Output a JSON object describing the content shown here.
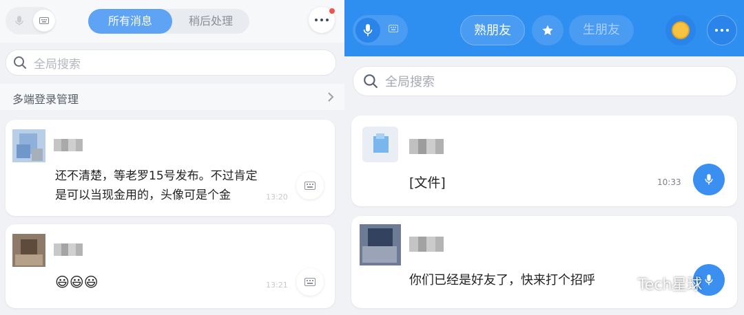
{
  "left": {
    "tabs": [
      {
        "label": "所有消息",
        "active": true
      },
      {
        "label": "稍后处理",
        "active": false
      }
    ],
    "search": {
      "placeholder": "全局搜索"
    },
    "multi_device": {
      "label": "多端登录管理"
    },
    "messages": [
      {
        "text_line1": "还不清楚，等老罗15号发布。不过肯定",
        "text_line2": "是可以当现金用的，头像可是个金",
        "time": "13:20"
      },
      {
        "text": "😃😃😃",
        "time": "13:21"
      }
    ],
    "notification_color": "#f0524f",
    "accent_color": "#5fa3f5"
  },
  "right": {
    "tabs": [
      {
        "label": "熟朋友",
        "active": true
      },
      {
        "label": "生朋友",
        "active": false
      }
    ],
    "search": {
      "placeholder": "全局搜索"
    },
    "messages": [
      {
        "text": "[文件]",
        "time": "10:33"
      },
      {
        "text": "你们已经是好友了，快来打个招呼"
      }
    ],
    "header_color": "#2f8ff0"
  },
  "watermark": {
    "text": "Tech星球"
  },
  "icons": [
    "microphone-icon",
    "keyboard-icon",
    "more-icon",
    "search-icon",
    "chevron-right-icon",
    "star-icon",
    "coin-icon",
    "wechat-logo-icon"
  ]
}
